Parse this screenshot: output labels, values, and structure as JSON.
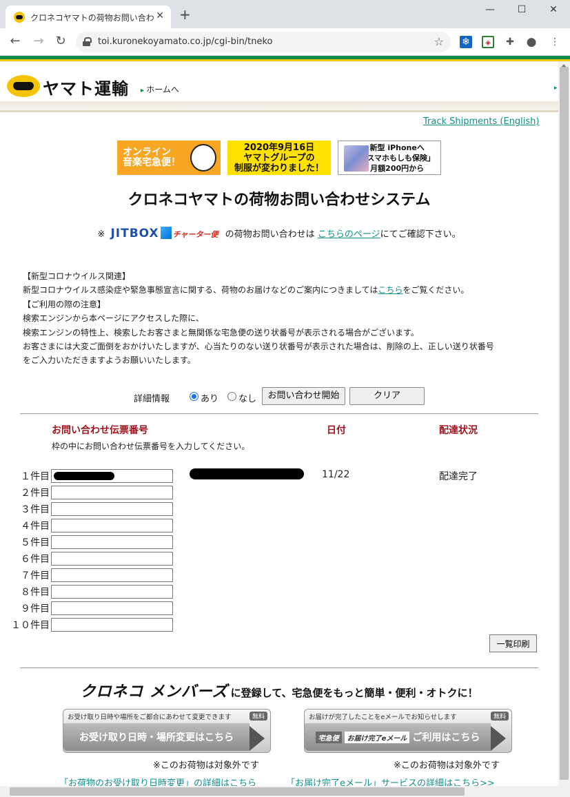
{
  "browser": {
    "tab_title": "クロネコヤマトの荷物お問い合わせシステム",
    "tab_close": "✕",
    "new_tab": "+",
    "url": "toi.kuronekoyamato.co.jp/cgi-bin/tneko",
    "window_min": "—",
    "window_max": "☐",
    "window_close": "✕",
    "back": "←",
    "forward": "→",
    "reload": "↻",
    "star": "☆",
    "menu": "⋮"
  },
  "header": {
    "logo_text": "ヤマト運輸",
    "home_link": "ホームへ"
  },
  "track_english": "Track Shipments (English)",
  "banners": {
    "b1": "オンライン\n音楽宅急便！",
    "b2_line1": "2020年9月16日",
    "b2_line2": "ヤマトグループの",
    "b2_line3": "制服が変わりました！",
    "b3_line1": "新型 iPhoneへ",
    "b3_line2": "「スマホもしも保険」",
    "b3_line3": "月額200円から"
  },
  "page_title": "クロネコヤマトの荷物お問い合わせシステム",
  "jitbox": {
    "mark": "※",
    "logo": "JITBOX",
    "charter": "チャーター便",
    "text_before": "の荷物お問い合わせは",
    "link": "こちらのページ",
    "text_after": "にてご確認下さい。"
  },
  "notice": {
    "h1": "【新型コロナウイルス関連】",
    "p1_before": "新型コロナウイルス感染症や緊急事態宣言に関する、荷物のお届けなどのご案内につきましては",
    "p1_link": "こちら",
    "p1_after": "をご覧ください。",
    "h2": "【ご利用の際の注意】",
    "p2": "検索エンジンから本ページにアクセスした際に、",
    "p3": "検索エンジンの特性上、検索したお客さまと無関係な宅急便の送り状番号が表示される場合がございます。",
    "p4": "お客さまには大変ご面倒をおかけいたしますが、心当たりのない送り状番号が表示された場合は、削除の上、正しい送り状番号",
    "p5": "をご入力いただきますようお願いいたします。"
  },
  "options": {
    "label": "詳細情報",
    "radio_yes": "あり",
    "radio_no": "なし",
    "selected": "あり",
    "start_button": "お問い合わせ開始",
    "clear_button": "クリア"
  },
  "table": {
    "col_number": "お問い合わせ伝票番号",
    "col_date": "日付",
    "col_status": "配達状況",
    "instruction": "枠の中にお問い合わせ伝票番号を入力してください。",
    "rows": [
      {
        "label": "１件目",
        "value": "",
        "date": "11/22",
        "status": "配達完了"
      },
      {
        "label": "２件目",
        "value": ""
      },
      {
        "label": "３件目",
        "value": ""
      },
      {
        "label": "４件目",
        "value": ""
      },
      {
        "label": "５件目",
        "value": ""
      },
      {
        "label": "６件目",
        "value": ""
      },
      {
        "label": "７件目",
        "value": ""
      },
      {
        "label": "８件目",
        "value": ""
      },
      {
        "label": "９件目",
        "value": ""
      },
      {
        "label": "１０件目",
        "value": ""
      }
    ],
    "print_button": "一覧印刷"
  },
  "members": {
    "logo": "クロネコ メンバーズ",
    "text": "に登録して、宅急便をもっと簡単・便利・オトクに！"
  },
  "services": {
    "left_caption": "お受け取り日時や場所をご都合にあわせて変更できます",
    "left_badge": "無料",
    "left_label": "お受け取り日時・場所変更はこちら",
    "left_note": "※このお荷物は対象外です",
    "left_link": "「お荷物のお受け取り日時変更」の詳細はこちら",
    "right_caption": "お届けが完了したことをeメールでお知らせします",
    "right_badge": "無料",
    "right_chip1": "宅急便",
    "right_chip2": "お届け完了eメール",
    "right_label": "ご利用はこちら",
    "right_note": "※このお荷物は対象外です",
    "right_link": "「お届け完了eメール」サービスの詳細はこちら>>"
  },
  "colors": {
    "brand_green": "#0f8a4a",
    "brand_yellow": "#f4c400",
    "heading_red": "#a0141e",
    "link_teal": "#118f8a"
  }
}
